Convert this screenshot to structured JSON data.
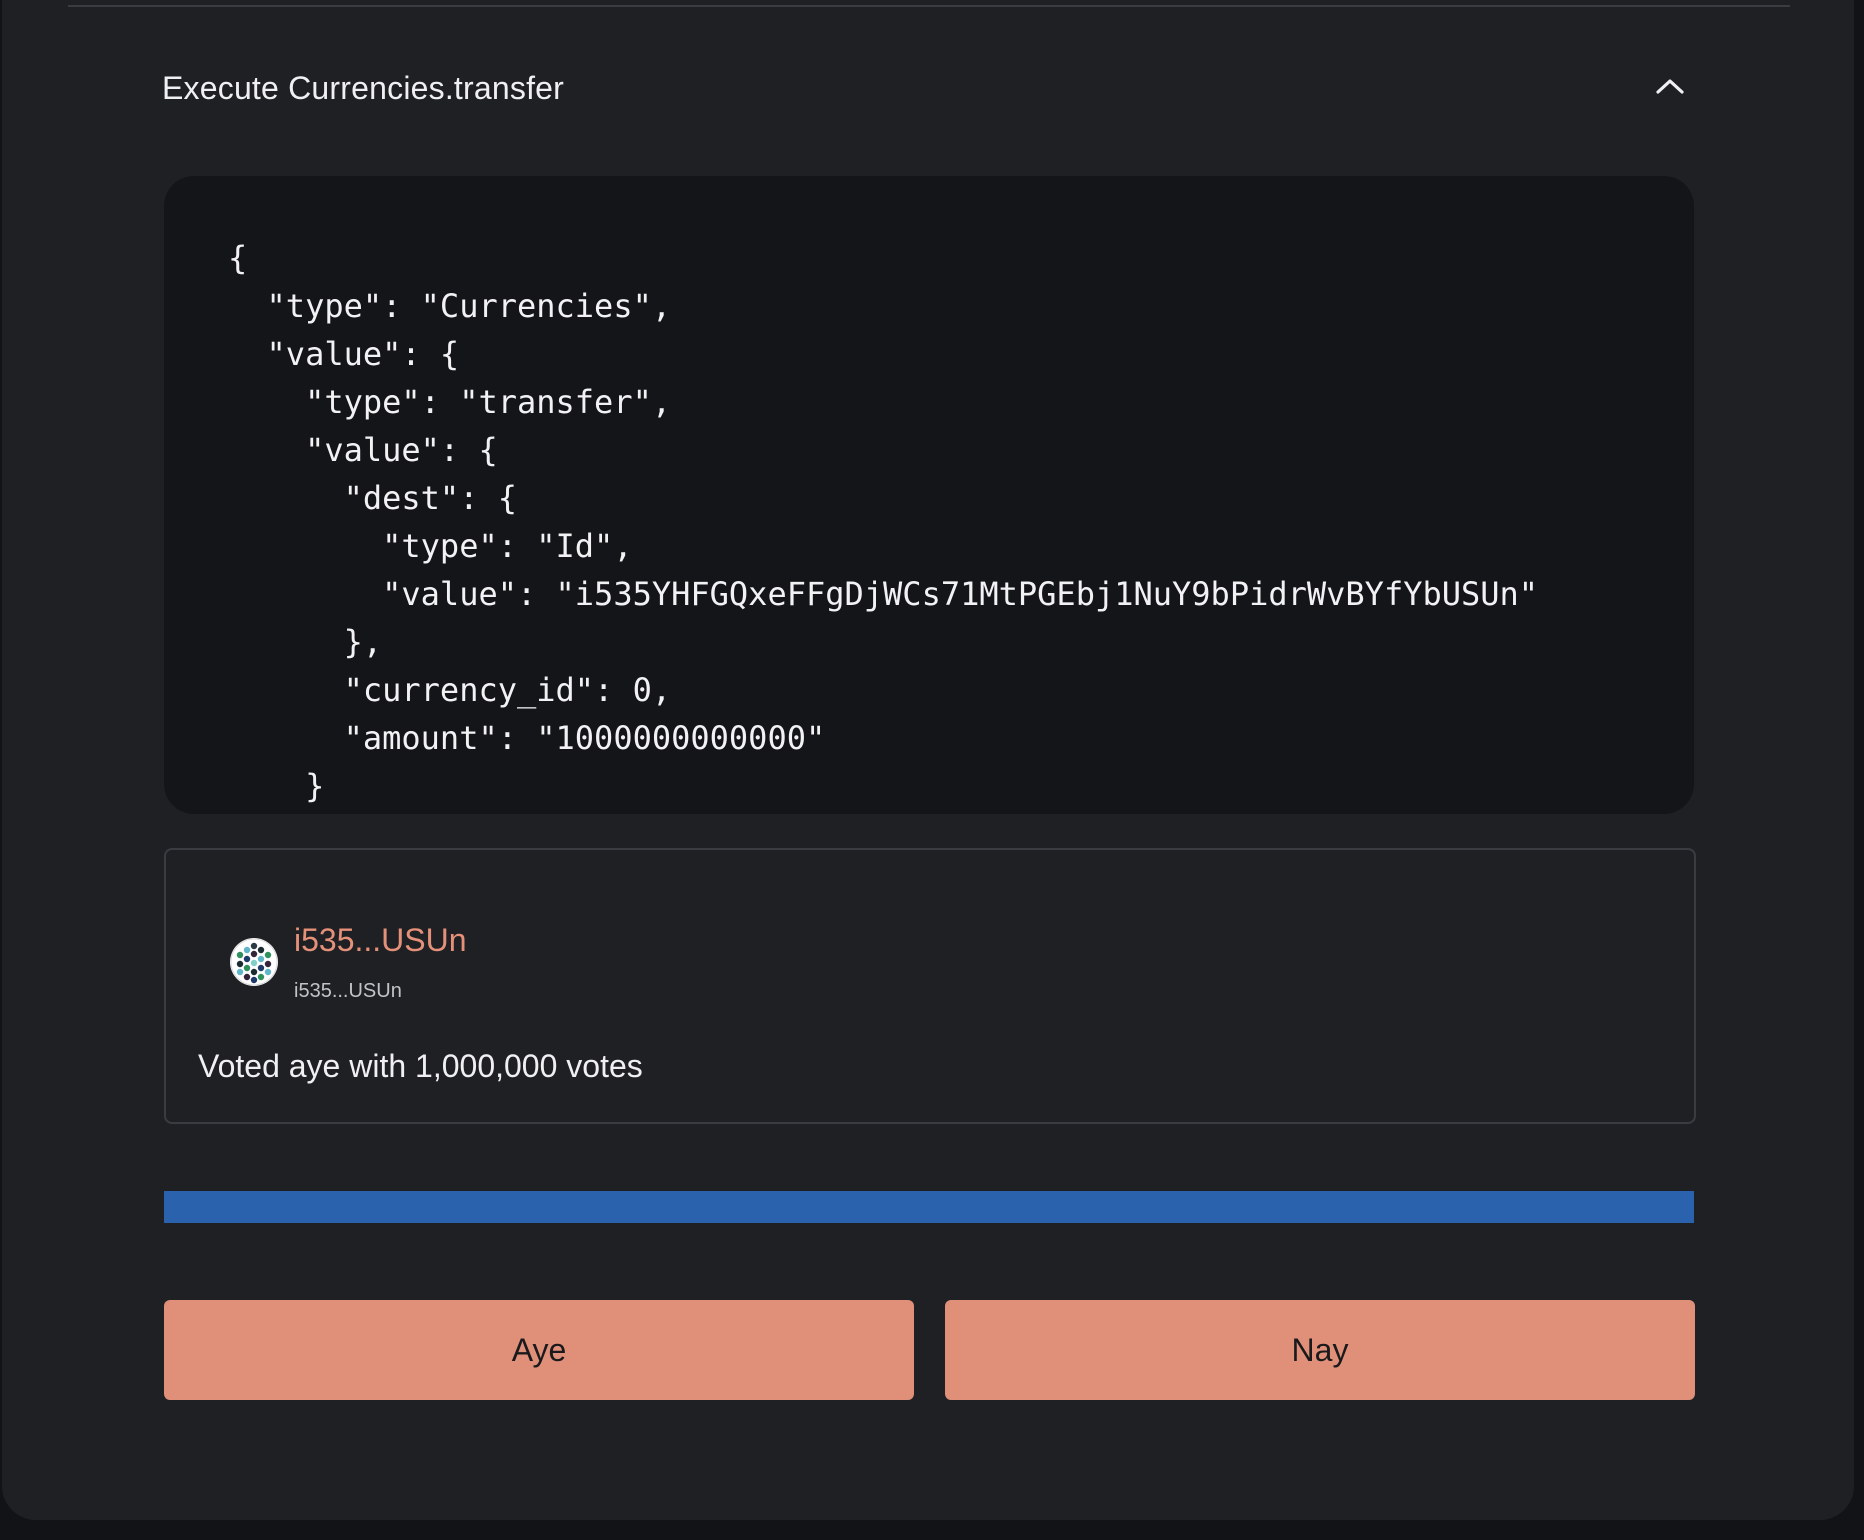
{
  "proposal": {
    "title": "Execute Currencies.transfer",
    "collapse_icon": "chevron-up-icon",
    "call_json_lines": [
      "{",
      "  \"type\": \"Currencies\",",
      "  \"value\": {",
      "    \"type\": \"transfer\",",
      "    \"value\": {",
      "      \"dest\": {",
      "        \"type\": \"Id\",",
      "        \"value\": \"i535YHFGQxeFFgDjWCs71MtPGEbj1NuY9bPidrWvBYfYbUSUn\"",
      "      },",
      "      \"currency_id\": 0,",
      "      \"amount\": \"1000000000000\"",
      "    }"
    ]
  },
  "vote": {
    "voter_name": "i535...USUn",
    "voter_address": "i535...USUn",
    "avatar_icon": "identicon-avatar",
    "summary": "Voted aye with 1,000,000 votes"
  },
  "tally": {
    "aye_fraction": 1.0,
    "aye_color": "#2a62ad"
  },
  "actions": {
    "aye_label": "Aye",
    "nay_label": "Nay",
    "button_color": "#e09079"
  },
  "colors": {
    "card_bg": "#1f2024",
    "code_bg": "#141518",
    "accent_text": "#e5917a"
  }
}
